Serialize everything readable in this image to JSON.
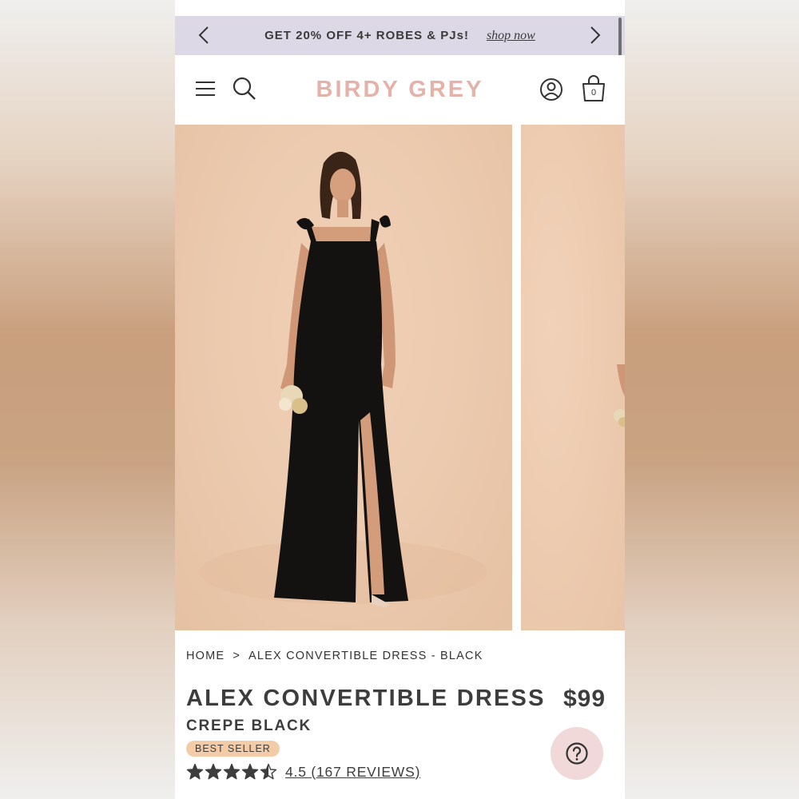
{
  "promo": {
    "text": "GET 20% OFF 4+ ROBES & PJs!",
    "link": "shop now"
  },
  "header": {
    "logo": "BIRDY GREY",
    "cart_count": "0"
  },
  "breadcrumb": {
    "home": "HOME",
    "separator": ">",
    "current": "ALEX CONVERTIBLE DRESS - BLACK"
  },
  "product": {
    "title": "ALEX CONVERTIBLE DRESS",
    "price": "$99",
    "color": "CREPE BLACK",
    "badge": "BEST SELLER",
    "rating_value": 4.5,
    "rating_max": 5,
    "rating_text": "4.5 (167 REVIEWS)"
  },
  "icons": {
    "prev": "chevron-left-icon",
    "next": "chevron-right-icon",
    "menu": "hamburger-menu-icon",
    "search": "search-icon",
    "account": "user-icon",
    "cart": "shopping-bag-icon",
    "help": "question-mark-icon"
  },
  "colors": {
    "promo_bg": "#ddd8e6",
    "logo": "#e4b2a8",
    "badge_bg": "#f3cba6",
    "help_bg": "#f2d9d9",
    "text": "#3d3d3d"
  }
}
